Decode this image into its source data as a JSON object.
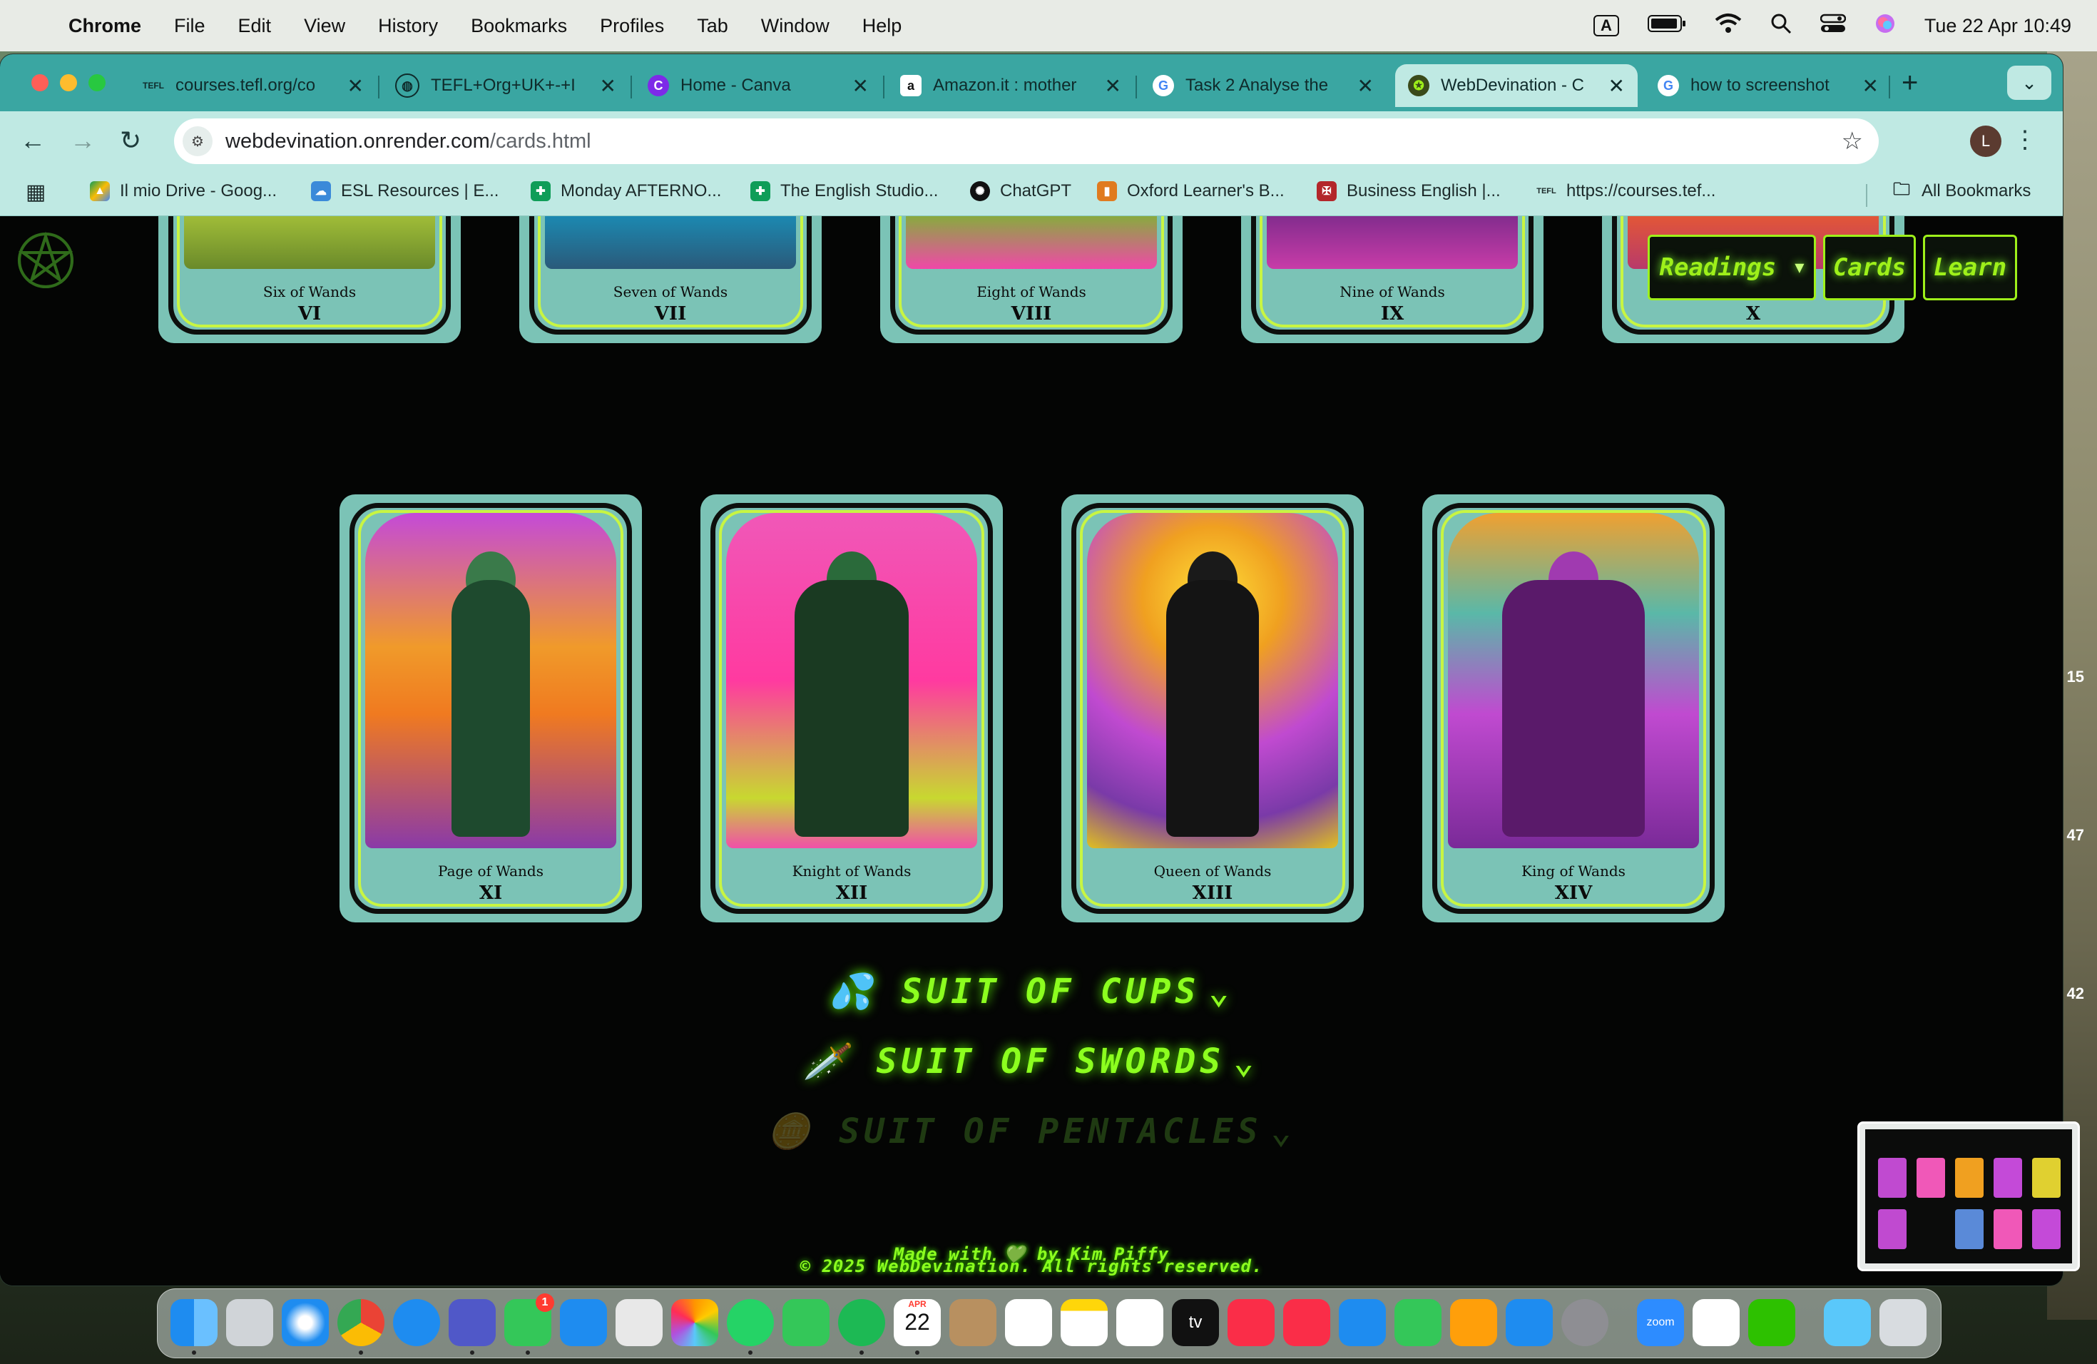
{
  "menubar": {
    "app": "Chrome",
    "items": [
      "File",
      "Edit",
      "View",
      "History",
      "Bookmarks",
      "Profiles",
      "Tab",
      "Window",
      "Help"
    ],
    "input_source": "A",
    "clock": "Tue 22 Apr  10:49"
  },
  "tabs": [
    {
      "title": "courses.tefl.org/co",
      "icon": "tefl-icon"
    },
    {
      "title": "TEFL+Org+UK+-+I",
      "icon": "globe-icon"
    },
    {
      "title": "Home - Canva",
      "icon": "canva-icon"
    },
    {
      "title": "Amazon.it : mother",
      "icon": "amazon-icon"
    },
    {
      "title": "Task 2 Analyse the",
      "icon": "google-icon"
    },
    {
      "title": "WebDevination - C",
      "icon": "webdevination-icon",
      "active": true
    },
    {
      "title": "how to screenshot",
      "icon": "google-icon"
    }
  ],
  "address": {
    "host": "webdevination.onrender.com",
    "path": "/cards.html"
  },
  "profile_initial": "L",
  "bookmarks": [
    {
      "label": "Il mio Drive - Goog...",
      "icon": "drive-icon"
    },
    {
      "label": "ESL Resources | E...",
      "icon": "esl-icon"
    },
    {
      "label": "Monday AFTERNO...",
      "icon": "sheets-icon"
    },
    {
      "label": "The English Studio...",
      "icon": "sheets-icon"
    },
    {
      "label": "ChatGPT",
      "icon": "chatgpt-icon"
    },
    {
      "label": "Oxford Learner's B...",
      "icon": "oxford-icon"
    },
    {
      "label": "Business English |...",
      "icon": "cambridge-icon"
    },
    {
      "label": "https://courses.tef...",
      "icon": "tefl-icon"
    }
  ],
  "all_bookmarks": "All Bookmarks",
  "nav": {
    "readings": "Readings",
    "cards": "Cards",
    "learn": "Learn"
  },
  "top_cards": [
    {
      "name": "Six of Wands",
      "num": "VI"
    },
    {
      "name": "Seven of Wands",
      "num": "VII"
    },
    {
      "name": "Eight of Wands",
      "num": "VIII"
    },
    {
      "name": "Nine of Wands",
      "num": "IX"
    },
    {
      "name": "",
      "num": "X"
    }
  ],
  "court_cards": [
    {
      "name": "Page of Wands",
      "num": "XI"
    },
    {
      "name": "Knight of Wands",
      "num": "XII"
    },
    {
      "name": "Queen of Wands",
      "num": "XIII"
    },
    {
      "name": "King of Wands",
      "num": "XIV"
    }
  ],
  "suits": [
    {
      "icon": "💦",
      "label": "SUIT OF CUPS"
    },
    {
      "icon": "🗡️",
      "label": "SUIT OF SWORDS"
    },
    {
      "icon": "🪙",
      "label": "SUIT OF PENTACLES"
    }
  ],
  "footer": {
    "copyright": "© 2025 WebDevination. All rights reserved.",
    "made_with": "Made with 💚 by Kim Piffy"
  },
  "side_numbers": [
    "15",
    "47",
    "42"
  ],
  "dock": {
    "calendar_month": "APR",
    "calendar_day": "22",
    "messages_badge": "1",
    "zoom": "zoom",
    "tv": "tv"
  },
  "colors": {
    "neon": "#8cff1f",
    "tab_teal": "#3aa6a2",
    "toolbar": "#bfe9e3"
  }
}
